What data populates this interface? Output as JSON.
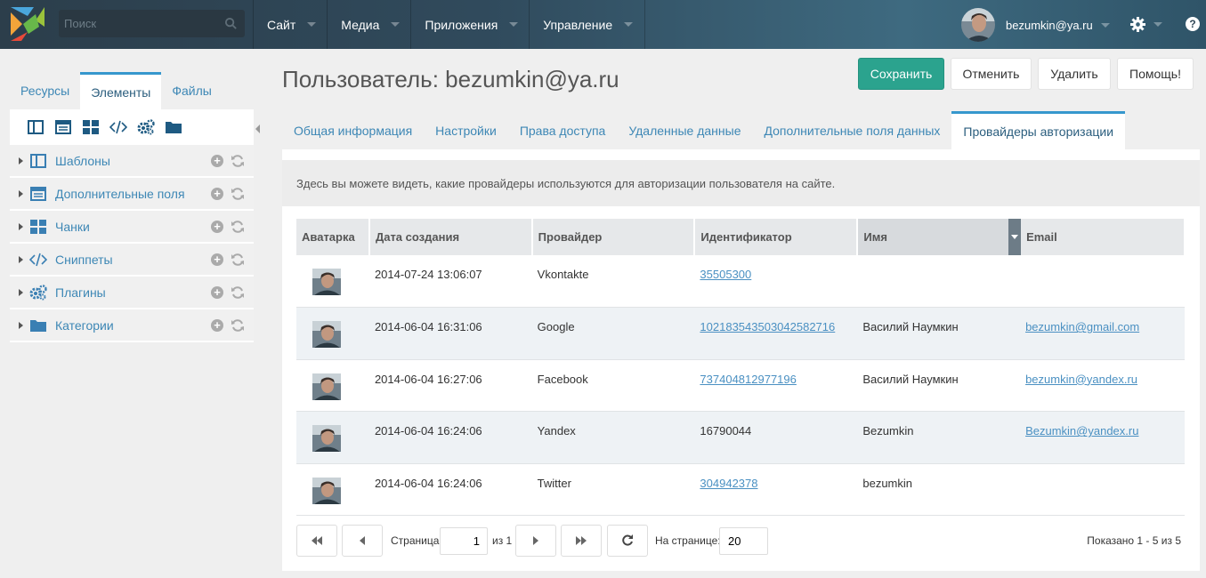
{
  "search": {
    "placeholder": "Поиск"
  },
  "topmenu": [
    {
      "label": "Сайт"
    },
    {
      "label": "Медиа"
    },
    {
      "label": "Приложения"
    },
    {
      "label": "Управление"
    }
  ],
  "user": {
    "name": "bezumkin@ya.ru"
  },
  "help_label": "?",
  "left_tabs": [
    "Ресурсы",
    "Элементы",
    "Файлы"
  ],
  "tree_toolbar_icons": [
    "template-icon",
    "tv-icon",
    "chunk-icon",
    "snippet-icon",
    "plugin-icon",
    "category-icon"
  ],
  "tree": [
    {
      "label": "Шаблоны",
      "icon": "template-icon"
    },
    {
      "label": "Дополнительные поля",
      "icon": "tv-icon"
    },
    {
      "label": "Чанки",
      "icon": "chunk-icon"
    },
    {
      "label": "Сниппеты",
      "icon": "snippet-icon"
    },
    {
      "label": "Плагины",
      "icon": "plugin-icon"
    },
    {
      "label": "Категории",
      "icon": "category-icon"
    }
  ],
  "page": {
    "title": "Пользователь: bezumkin@ya.ru"
  },
  "actions": {
    "save": "Сохранить",
    "cancel": "Отменить",
    "delete": "Удалить",
    "help": "Помощь!"
  },
  "tabs": [
    "Общая информация",
    "Настройки",
    "Права доступа",
    "Удаленные данные",
    "Дополнительные поля данных",
    "Провайдеры авторизации"
  ],
  "info": "Здесь вы можете видеть, какие провайдеры используются для авторизации пользователя на сайте.",
  "grid": {
    "columns": [
      "Аватарка",
      "Дата создания",
      "Провайдер",
      "Идентификатор",
      "Имя",
      "Email"
    ],
    "rows": [
      {
        "date": "2014-07-24 13:06:07",
        "provider": "Vkontakte",
        "id": "35505300",
        "id_link": true,
        "name": "",
        "email": ""
      },
      {
        "date": "2014-06-04 16:31:06",
        "provider": "Google",
        "id": "102183543503042582716",
        "id_link": true,
        "name": "Василий Наумкин",
        "email": "bezumkin@gmail.com"
      },
      {
        "date": "2014-06-04 16:27:06",
        "provider": "Facebook",
        "id": "737404812977196",
        "id_link": true,
        "name": "Василий Наумкин",
        "email": "bezumkin@yandex.ru"
      },
      {
        "date": "2014-06-04 16:24:06",
        "provider": "Yandex",
        "id": "16790044",
        "id_link": false,
        "name": "Bezumkin",
        "email": "Bezumkin@yandex.ru"
      },
      {
        "date": "2014-06-04 16:24:06",
        "provider": "Twitter",
        "id": "304942378",
        "id_link": true,
        "name": "bezumkin",
        "email": ""
      }
    ]
  },
  "pager": {
    "page_label": "Страница",
    "page": "1",
    "of_label": "из 1",
    "per_page_label": "На странице:",
    "per_page": "20",
    "shown": "Показано 1 - 5 из 5"
  },
  "colors": {
    "accent": "#3697cd",
    "save": "#2ba38e",
    "link": "#4a90c2"
  }
}
